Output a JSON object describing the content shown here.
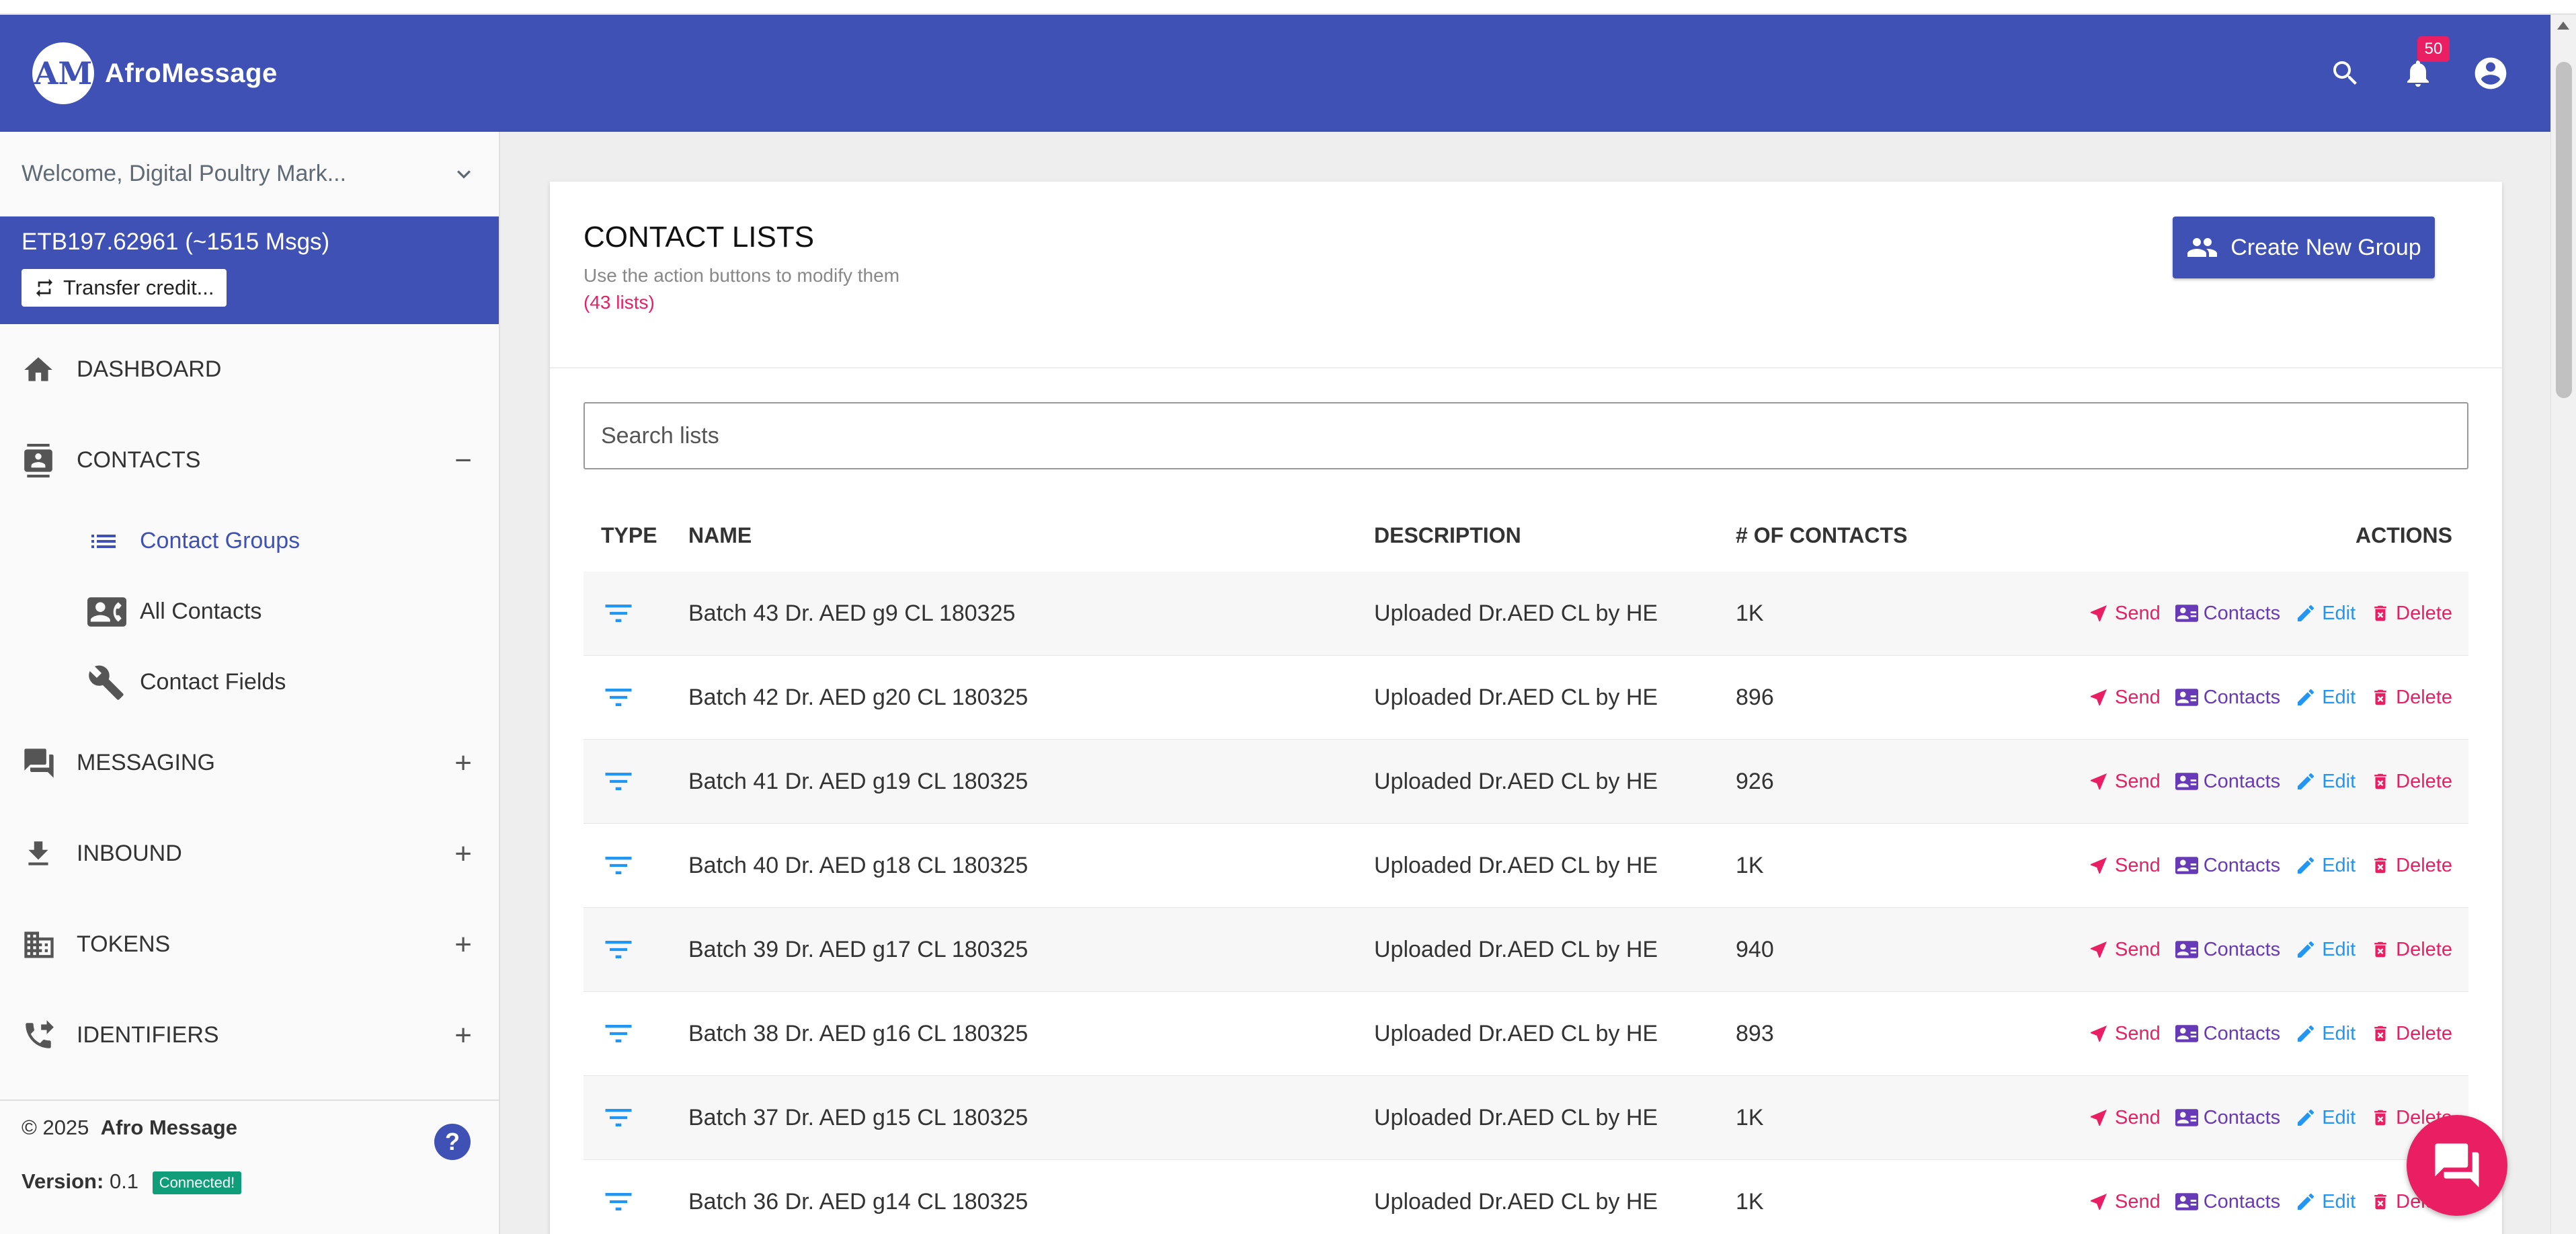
{
  "app": {
    "brand": "AfroMessage",
    "logo_mark": "AM",
    "notification_count": "50",
    "icons": {
      "search": "search-icon",
      "notifications": "bell-icon",
      "account": "account-circle-icon"
    },
    "colors": {
      "primary": "#3f51b5",
      "accent": "#e91e63",
      "contacts": "#673ab7",
      "edit": "#2196f3",
      "connected": "#0f9d7a"
    }
  },
  "sidebar": {
    "welcome": "Welcome, Digital Poultry Mark...",
    "balance": "ETB197.62961 (~1515 Msgs)",
    "transfer_label": "Transfer credit...",
    "nav": {
      "dashboard": "DASHBOARD",
      "contacts": "CONTACTS",
      "contacts_toggle": "−",
      "sub": {
        "groups": "Contact Groups",
        "all": "All Contacts",
        "fields": "Contact Fields"
      },
      "messaging": "MESSAGING",
      "inbound": "INBOUND",
      "tokens": "TOKENS",
      "identifiers": "IDENTIFIERS",
      "expand": "+"
    },
    "footer": {
      "copyright": "© 2025",
      "company": "Afro Message",
      "version_label": "Version:",
      "version": "0.1",
      "status": "Connected!",
      "help": "?"
    }
  },
  "main": {
    "title": "CONTACT LISTS",
    "subtitle": "Use the action buttons to modify them",
    "count": "(43 lists)",
    "create_label": "Create New Group",
    "search_placeholder": "Search lists",
    "columns": {
      "type": "TYPE",
      "name": "NAME",
      "description": "DESCRIPTION",
      "contacts": "# OF CONTACTS",
      "actions": "ACTIONS"
    },
    "actions": {
      "send": "Send",
      "contacts": "Contacts",
      "edit": "Edit",
      "delete": "Delete"
    },
    "rows": [
      {
        "name": "Batch 43 Dr. AED g9 CL 180325",
        "description": "Uploaded Dr.AED CL by HE",
        "count": "1K"
      },
      {
        "name": "Batch 42 Dr. AED g20 CL 180325",
        "description": "Uploaded Dr.AED CL by HE",
        "count": "896"
      },
      {
        "name": "Batch 41 Dr. AED g19 CL 180325",
        "description": "Uploaded Dr.AED CL by HE",
        "count": "926"
      },
      {
        "name": "Batch 40 Dr. AED g18 CL 180325",
        "description": "Uploaded Dr.AED CL by HE",
        "count": "1K"
      },
      {
        "name": "Batch 39 Dr. AED g17 CL 180325",
        "description": "Uploaded Dr.AED CL by HE",
        "count": "940"
      },
      {
        "name": "Batch 38 Dr. AED g16 CL 180325",
        "description": "Uploaded Dr.AED CL by HE",
        "count": "893"
      },
      {
        "name": "Batch 37 Dr. AED g15 CL 180325",
        "description": "Uploaded Dr.AED CL by HE",
        "count": "1K"
      },
      {
        "name": "Batch 36 Dr. AED g14 CL 180325",
        "description": "Uploaded Dr.AED CL by HE",
        "count": "1K"
      }
    ]
  }
}
